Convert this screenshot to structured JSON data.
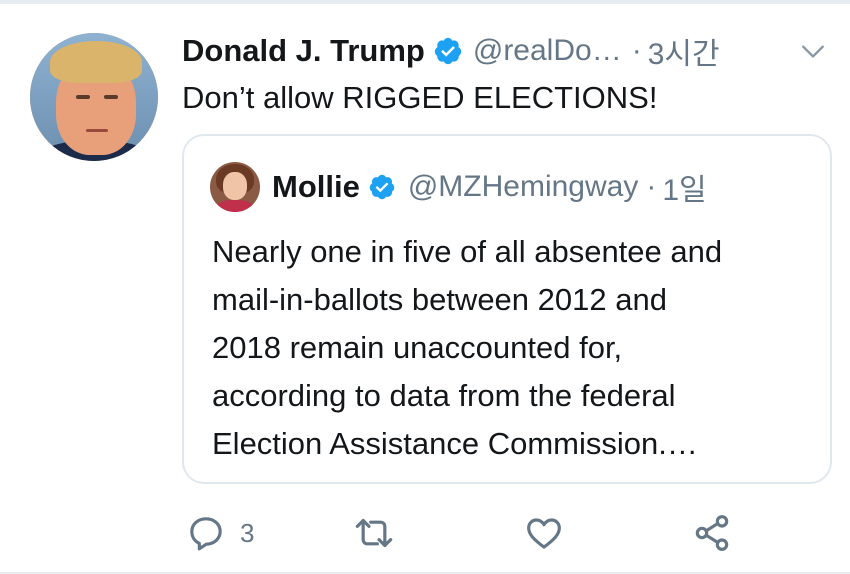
{
  "tweet": {
    "author_name": "Donald J. Trump",
    "handle": "@realDo…",
    "dot": "·",
    "time": "3시간",
    "text": "Don’t allow RIGGED ELECTIONS!",
    "verified": true
  },
  "quote": {
    "author_name": "Mollie",
    "handle": "@MZHemingway",
    "dot": "·",
    "time": "1일",
    "verified": true,
    "lines": [
      "Nearly one in five of all absentee and",
      "mail-in-ballots between 2012 and",
      "2018 remain unaccounted for,",
      "according to data from the federal",
      "Election Assistance Commission.…"
    ]
  },
  "actions": {
    "reply_count": "3",
    "icons": [
      "reply-icon",
      "retweet-icon",
      "like-icon",
      "share-icon"
    ]
  },
  "colors": {
    "verified_blue": "#1da1f2",
    "secondary_text": "#657786",
    "border": "#e1e8ed"
  }
}
